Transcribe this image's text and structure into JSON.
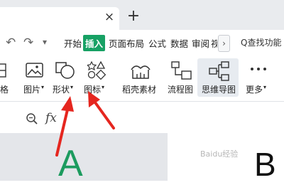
{
  "tabs": {
    "close_glyph": "×",
    "new_glyph": "+"
  },
  "quick_access": {
    "undo_icon": "undo-icon",
    "redo_icon": "redo-icon",
    "dropdown_glyph": "▾"
  },
  "menu": {
    "items": [
      "开始",
      "插入",
      "页面布局",
      "公式",
      "数据",
      "审阅",
      "视"
    ],
    "active_index": 1,
    "more_glyph": "›"
  },
  "search": {
    "label": "Q查找功能"
  },
  "toolbar": {
    "partial_label": "格",
    "picture": "图片",
    "shape": "形状",
    "icon": "图标",
    "daoke": "稻壳素材",
    "flowchart": "流程图",
    "mindmap": "思维导图",
    "more": "更多",
    "dropdown_glyph": "▾"
  },
  "formula_bar": {
    "fx": "fx"
  },
  "sheet": {
    "col_a": "A",
    "col_b": "B"
  },
  "watermark": "Baidu经验",
  "colors": {
    "accent": "#17a164",
    "arrow": "#e5261f"
  }
}
